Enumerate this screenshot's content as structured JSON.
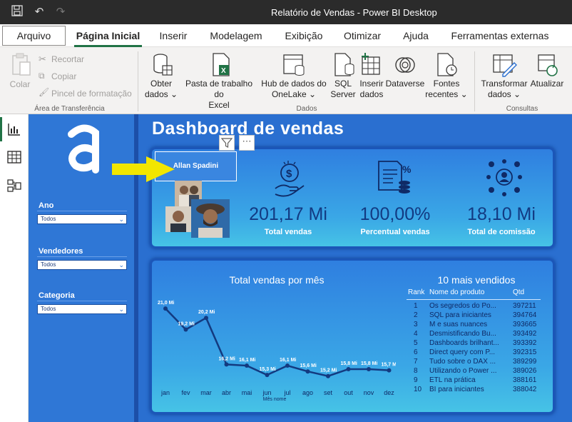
{
  "window": {
    "title": "Relatório de Vendas - Power BI Desktop"
  },
  "menu": {
    "file": "Arquivo",
    "tabs": [
      "Página Inicial",
      "Inserir",
      "Modelagem",
      "Exibição",
      "Otimizar",
      "Ajuda",
      "Ferramentas externas"
    ]
  },
  "ribbon": {
    "clipboard": {
      "paste": "Colar",
      "cut": "Recortar",
      "copy": "Copiar",
      "format_painter": "Pincel de formatação",
      "label": "Área de Transferência"
    },
    "data": {
      "get_data_1": "Obter",
      "get_data_2": "dados ⌄",
      "excel_1": "Pasta de trabalho do",
      "excel_2": "Excel",
      "onelake_1": "Hub de dados do",
      "onelake_2": "OneLake ⌄",
      "sql_1": "SQL",
      "sql_2": "Server",
      "insert_1": "Inserir",
      "insert_2": "dados",
      "dataverse": "Dataverse",
      "recent_1": "Fontes",
      "recent_2": "recentes ⌄",
      "label": "Dados"
    },
    "queries": {
      "transform_1": "Transformar",
      "transform_2": "dados ⌄",
      "refresh": "Atualizar",
      "label": "Consultas"
    }
  },
  "report": {
    "title": "Dashboard de vendas",
    "slicers": [
      {
        "title": "Ano",
        "value": "Todos"
      },
      {
        "title": "Vendedores",
        "value": "Todos"
      },
      {
        "title": "Categoria",
        "value": "Todos"
      }
    ],
    "selected_seller": "Allan Spadini",
    "kpis": [
      {
        "value": "201,17 Mi",
        "label": "Total vendas"
      },
      {
        "value": "100,00%",
        "label": "Percentual vendas"
      },
      {
        "value": "18,10 Mi",
        "label": "Total de comissão"
      }
    ],
    "table": {
      "title": "10 mais vendidos",
      "headers": [
        "Rank",
        "Nome do produto",
        "Qtd"
      ],
      "rows": [
        [
          "1",
          "Os segredos do Po...",
          "397211"
        ],
        [
          "2",
          "SQL para iniciantes",
          "394764"
        ],
        [
          "3",
          "M e suas nuances",
          "393665"
        ],
        [
          "4",
          "Desmistificando Bu...",
          "393492"
        ],
        [
          "5",
          "Dashboards brilhant...",
          "393392"
        ],
        [
          "6",
          "Direct query com P...",
          "392315"
        ],
        [
          "7",
          "Tudo sobre o DAX ...",
          "389299"
        ],
        [
          "8",
          "Utilizando o Power ...",
          "389026"
        ],
        [
          "9",
          "ETL na prática",
          "388161"
        ],
        [
          "10",
          "BI para iniciantes",
          "388042"
        ]
      ]
    }
  },
  "colors": {
    "accent": "#217346",
    "canvas": "#2a6fd0",
    "line": "#133a80",
    "arrow": "#f2e600"
  },
  "chart_data": {
    "type": "line",
    "title": "Total vendas por mês",
    "xlabel": "Mês nome",
    "ylabel": "",
    "categories": [
      "jan",
      "fev",
      "mar",
      "abr",
      "mai",
      "jun",
      "jul",
      "ago",
      "set",
      "out",
      "nov",
      "dez"
    ],
    "values": [
      21.0,
      19.2,
      20.2,
      16.2,
      16.1,
      15.3,
      16.1,
      15.6,
      15.2,
      15.8,
      15.8,
      15.7
    ],
    "data_labels": [
      "21,0 Mi",
      "19,2 Mi",
      "20,2 Mi",
      "16,2 Mi",
      "16,1 Mi",
      "15,3 Mi",
      "16,1 Mi",
      "15,6 Mi",
      "15,2 Mi",
      "15,8 Mi",
      "15,8 Mi",
      "15,7 Mi"
    ],
    "ylim": [
      15.0,
      21.5
    ],
    "grid": false
  }
}
